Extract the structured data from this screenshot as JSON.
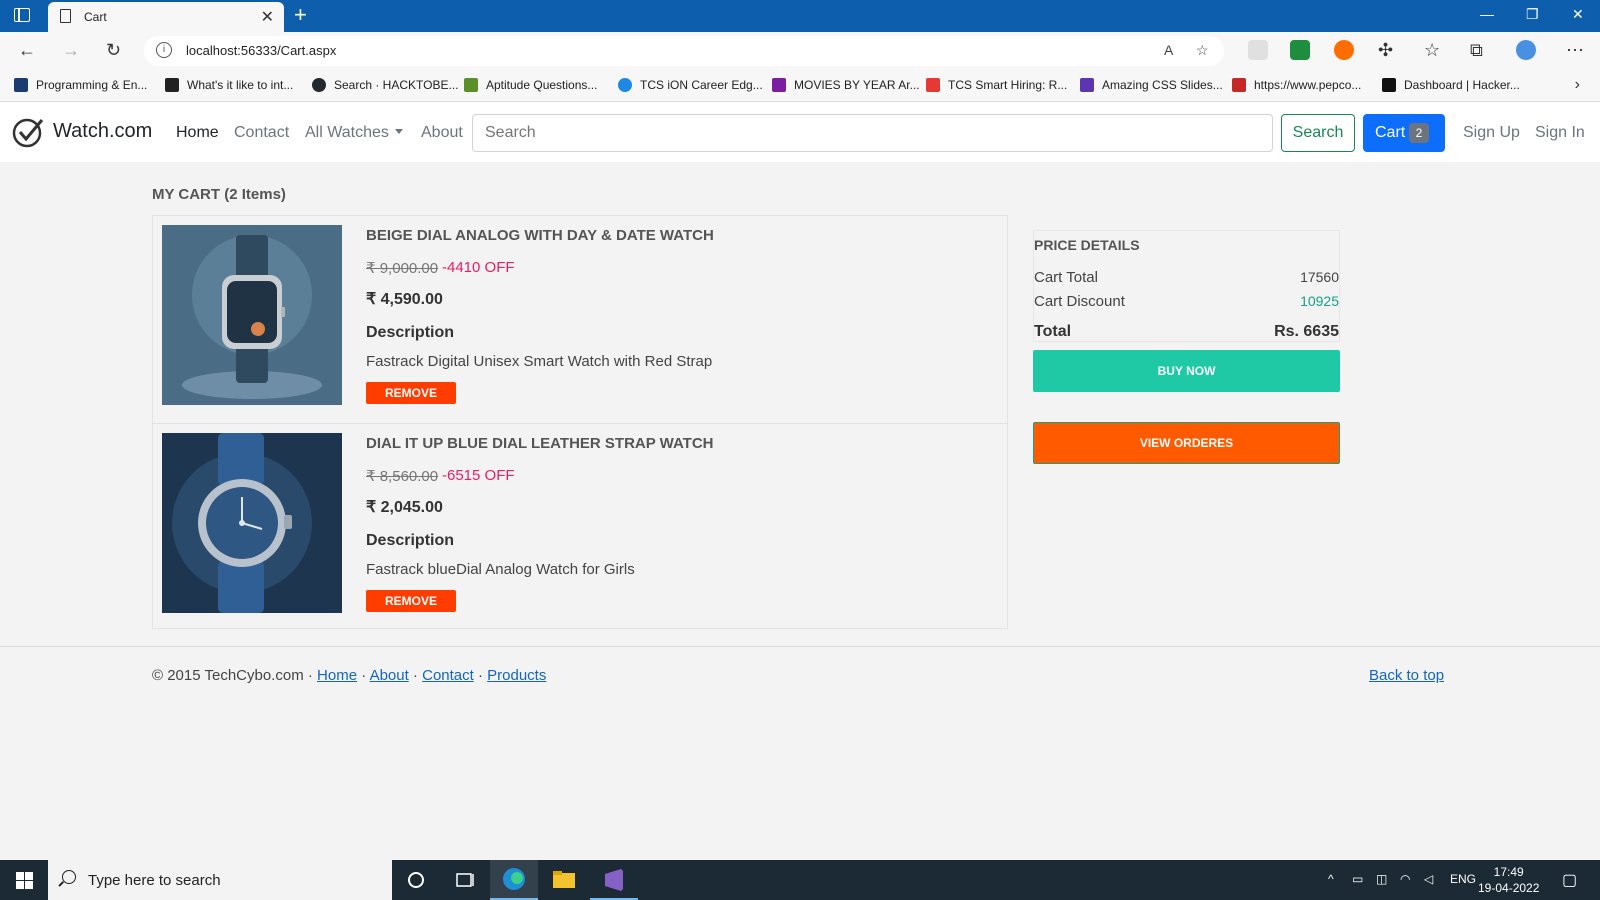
{
  "browser": {
    "tab_title": "Cart",
    "tab_close": "✕",
    "new_tab": "+",
    "url": "localhost:56333/Cart.aspx",
    "bookmarks": [
      {
        "label": "Programming & En...",
        "color": "#1a3c6e"
      },
      {
        "label": "What's it like to int...",
        "color": "#222222"
      },
      {
        "label": "Search · HACKTOBE...",
        "color": "#24292e"
      },
      {
        "label": "Aptitude Questions...",
        "color": "#5a8f29"
      },
      {
        "label": "TCS iON Career Edg...",
        "color": "#1e88e5"
      },
      {
        "label": "MOVIES BY YEAR Ar...",
        "color": "#7b1fa2"
      },
      {
        "label": "TCS Smart Hiring: R...",
        "color": "#e53935"
      },
      {
        "label": "Amazing CSS Slides...",
        "color": "#5e35b1"
      },
      {
        "label": "https://www.pepco...",
        "color": "#c62828"
      },
      {
        "label": "Dashboard | Hacker...",
        "color": "#111111"
      }
    ]
  },
  "navbar": {
    "brand": "Watch.com",
    "links": [
      "Home",
      "Contact",
      "All Watches",
      "About"
    ],
    "search_placeholder": "Search",
    "search_button": "Search",
    "cart_label": "Cart",
    "cart_count": "2",
    "sign_up": "Sign Up",
    "sign_in": "Sign In"
  },
  "cart": {
    "heading": "MY CART (2 Items)",
    "items": [
      {
        "title": "BEIGE DIAL ANALOG WITH DAY & DATE WATCH",
        "original_price": "₹ 9,000.00",
        "discount": "-4410 OFF",
        "price": "₹ 4,590.00",
        "description_heading": "Description",
        "description": "Fastrack Digital Unisex Smart Watch with Red Strap",
        "remove_label": "REMOVE"
      },
      {
        "title": "DIAL IT UP BLUE DIAL LEATHER STRAP WATCH",
        "original_price": "₹ 8,560.00",
        "discount": "-6515 OFF",
        "price": "₹ 2,045.00",
        "description_heading": "Description",
        "description": "Fastrack blueDial Analog Watch for Girls",
        "remove_label": "REMOVE"
      }
    ]
  },
  "price_details": {
    "title": "PRICE DETAILS",
    "cart_total_label": "Cart Total",
    "cart_total_value": "17560",
    "cart_discount_label": "Cart Discount",
    "cart_discount_value": "10925",
    "total_label": "Total",
    "total_value": "Rs. 6635",
    "buy_now": "BUY NOW",
    "view_orders": "VIEW ORDERES"
  },
  "footer": {
    "copyright": "© 2015 TechCybo.com · ",
    "links": [
      "Home",
      "About",
      "Contact",
      "Products"
    ],
    "separator": " · ",
    "back_to_top": "Back to top"
  },
  "taskbar": {
    "search_placeholder": "Type here to search",
    "language": "ENG",
    "time": "17:49",
    "date": "19-04-2022"
  }
}
